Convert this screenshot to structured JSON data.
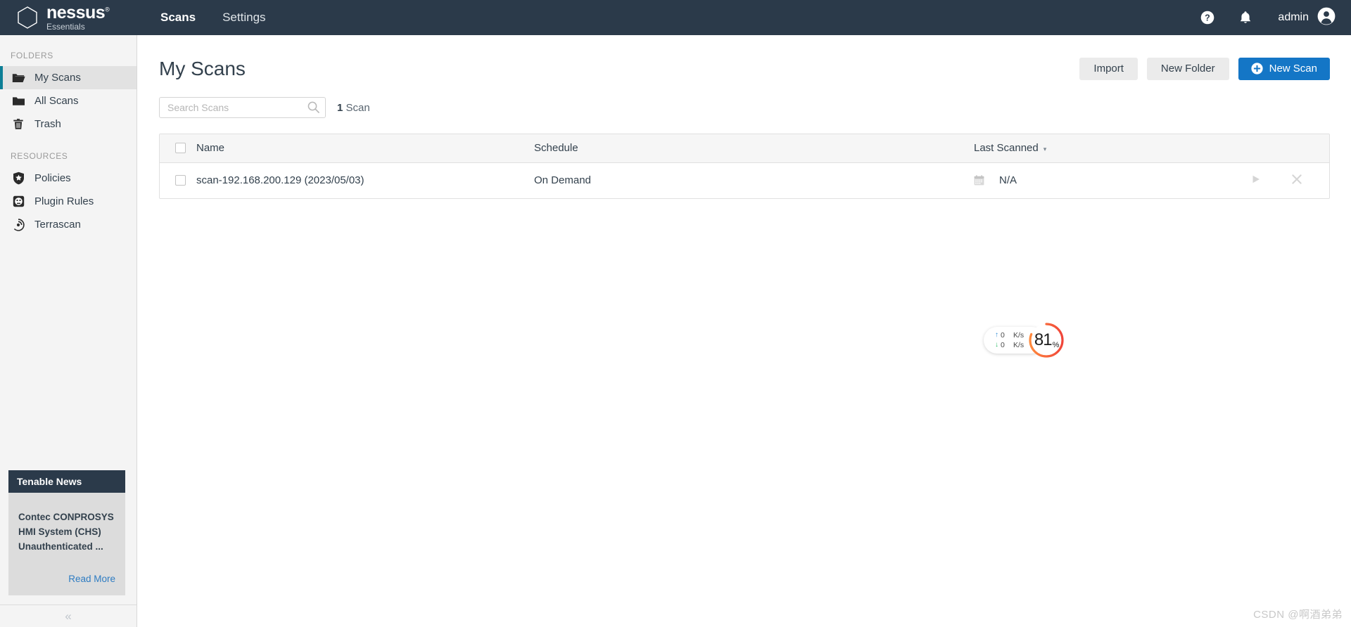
{
  "topnav": {
    "brand": {
      "name": "nessus",
      "trademark": "®",
      "sub": "Essentials",
      "logo_icon": "nessus-hexagon-logo"
    },
    "links": [
      {
        "label": "Scans",
        "active": true
      },
      {
        "label": "Settings",
        "active": false
      }
    ],
    "help_icon": "help-circle-icon",
    "notifications_icon": "bell-icon",
    "username": "admin",
    "avatar_icon": "user-avatar-icon",
    "background": "#2b3a4a"
  },
  "sidebar": {
    "folders_label": "FOLDERS",
    "folders": [
      {
        "label": "My Scans",
        "icon": "open-folder-icon",
        "active": true
      },
      {
        "label": "All Scans",
        "icon": "folder-icon",
        "active": false
      },
      {
        "label": "Trash",
        "icon": "trash-icon",
        "active": false
      }
    ],
    "resources_label": "RESOURCES",
    "resources": [
      {
        "label": "Policies",
        "icon": "shield-star-icon"
      },
      {
        "label": "Plugin Rules",
        "icon": "plugin-outlet-icon"
      },
      {
        "label": "Terrascan",
        "icon": "terrascan-radar-icon"
      }
    ],
    "news": {
      "header": "Tenable News",
      "title": "Contec CONPROSYS HMI System (CHS) Unauthenticated ...",
      "read_more": "Read More"
    },
    "collapse_icon": "chevron-double-left-icon",
    "accent": "#0d7f96"
  },
  "main": {
    "page_title": "My Scans",
    "actions": {
      "import": "Import",
      "new_folder": "New Folder",
      "new_scan": "New Scan",
      "new_scan_icon": "plus-circle-icon",
      "primary_color": "#1476c6"
    },
    "search": {
      "placeholder": "Search Scans",
      "value": "",
      "icon": "search-icon"
    },
    "scan_count": {
      "number": "1",
      "label": "Scan"
    },
    "table": {
      "columns": [
        {
          "key": "check",
          "label": "",
          "icon": "checkbox-icon"
        },
        {
          "key": "name",
          "label": "Name"
        },
        {
          "key": "schedule",
          "label": "Schedule"
        },
        {
          "key": "last_scanned",
          "label": "Last Scanned",
          "sort_caret": "▾"
        }
      ],
      "rows": [
        {
          "name": "scan-192.168.200.129  (2023/05/03)",
          "schedule": "On Demand",
          "last_scanned": "N/A",
          "calendar_icon": "calendar-icon",
          "launch_icon": "play-icon",
          "delete_icon": "close-x-icon"
        }
      ]
    }
  },
  "speed_widget": {
    "upload": {
      "arrow": "↑",
      "value": "0",
      "unit": "K/s"
    },
    "download": {
      "arrow": "↓",
      "value": "0",
      "unit": "K/s"
    },
    "percent": "81",
    "percent_symbol": "%",
    "ring_color_start": "#ff8a3d",
    "ring_color_end": "#f0453a"
  },
  "watermark": {
    "text": "CSDN @啊酒弟弟"
  }
}
